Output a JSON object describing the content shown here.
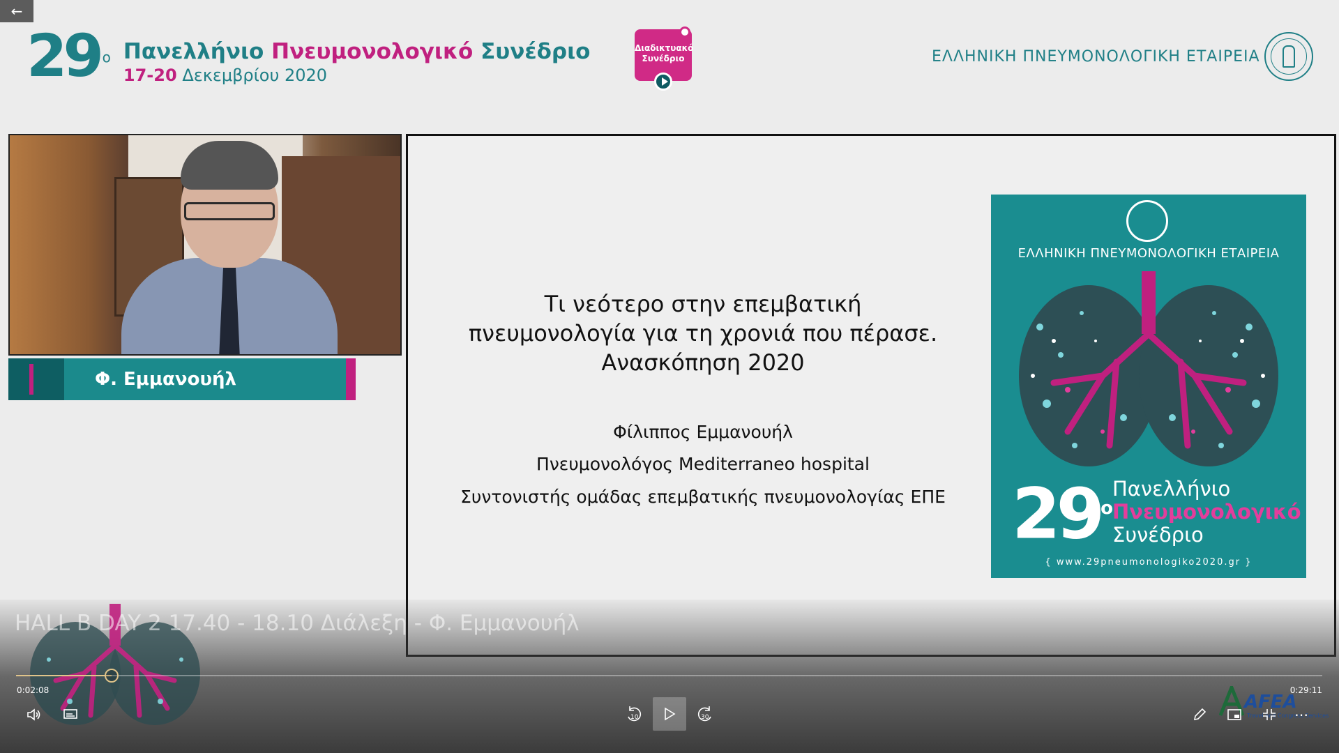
{
  "header": {
    "conference_number": "29",
    "conference_number_sup": "ο",
    "title_part1": "Πανελλήνιο",
    "title_part2": "Πνευμονολογικό",
    "title_part3": "Συνέδριο",
    "dates_bold": "17-20",
    "dates_rest": "Δεκεμβρίου 2020",
    "online_badge_line1": "Διαδικτυακό",
    "online_badge_line2": "Συνέδριο",
    "society_name": "ΕΛΛΗΝΙΚΗ ΠΝΕΥΜΟΝΟΛΟΓΙΚΗ ΕΤΑΙΡΕΙΑ"
  },
  "speaker": {
    "name": "Φ. Εμμανουήλ"
  },
  "slide": {
    "title_line1": "Τι νεότερο στην επεμβατική",
    "title_line2": "πνευμονολογία για τη χρονιά που πέρασε.",
    "title_line3": "Ανασκόπηση 2020",
    "author": "Φίλιππος Εμμανουήλ",
    "role": "Πνευμονολόγος Mediterraneo hospital",
    "position": "Συντονιστής ομάδας επεμβατικής πνευμονολογίας ΕΠΕ",
    "poster": {
      "society": "ΕΛΛΗΝΙΚΗ ΠΝΕΥΜΟΝΟΛΟΓΙΚΗ ΕΤΑΙΡΕΙΑ",
      "number": "29",
      "number_sup": "ο",
      "line1": "Πανελλήνιο",
      "line2": "Πνευμονολογικό",
      "line3": "Συνέδριο",
      "url": "{ www.29pneumonologiko2020.gr }"
    }
  },
  "player": {
    "video_title": "HALL B DAY 2 17.40 - 18.10 Διάλεξη - Φ. Εμμανουήλ",
    "time_current": "0:02:08",
    "time_total": "0:29:11",
    "progress_fraction": 0.0731,
    "skip_back_label": "10",
    "skip_forward_label": "30",
    "sponsor_name": "AFEA",
    "sponsor_sub": "Travel and Congress Services"
  },
  "colors": {
    "teal": "#1f7f86",
    "magenta": "#c0207f",
    "progress": "#e0c48a"
  },
  "icons": {
    "back": "arrow-left-icon",
    "volume": "volume-icon",
    "captions": "captions-icon",
    "replay": "replay-10-icon",
    "play": "play-icon",
    "forward": "forward-30-icon",
    "pen": "pen-icon",
    "pip": "picture-in-picture-icon",
    "fullscreen": "fullscreen-exit-icon"
  }
}
